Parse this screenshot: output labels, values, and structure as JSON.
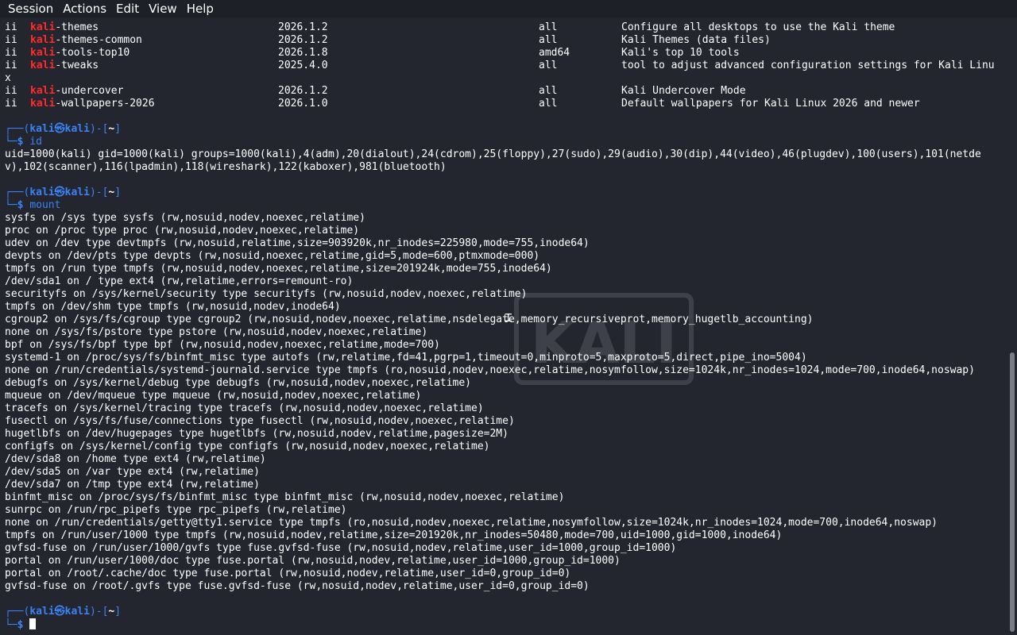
{
  "menubar": {
    "items": [
      "Session",
      "Actions",
      "Edit",
      "View",
      "Help"
    ]
  },
  "packages": [
    {
      "status": "ii",
      "prefix": "kali",
      "suffix": "-themes",
      "version": "2026.1.2",
      "arch": "all",
      "desc": "Configure all desktops to use the Kali theme"
    },
    {
      "status": "ii",
      "prefix": "kali",
      "suffix": "-themes-common",
      "version": "2026.1.2",
      "arch": "all",
      "desc": "Kali Themes (data files)"
    },
    {
      "status": "ii",
      "prefix": "kali",
      "suffix": "-tools-top10",
      "version": "2026.1.8",
      "arch": "amd64",
      "desc": "Kali's top 10 tools"
    },
    {
      "status": "ii",
      "prefix": "kali",
      "suffix": "-tweaks",
      "version": "2025.4.0",
      "arch": "all",
      "desc": "tool to adjust advanced configuration settings for Kali Linu"
    }
  ],
  "tweaks_wrap": "x",
  "packages_after": [
    {
      "status": "ii",
      "prefix": "kali",
      "suffix": "-undercover",
      "version": "2026.1.2",
      "arch": "all",
      "desc": "Kali Undercover Mode"
    },
    {
      "status": "ii",
      "prefix": "kali",
      "suffix": "-wallpapers-2026",
      "version": "2026.1.0",
      "arch": "all",
      "desc": "Default wallpapers for Kali Linux 2026 and newer"
    }
  ],
  "prompt": {
    "top_left": "┌──(",
    "user_host": "kali㉿kali",
    "mid": ")-[",
    "path": "~",
    "end": "]",
    "bottom": "└─",
    "dollar": "$"
  },
  "commands": {
    "id": "id",
    "mount": "mount"
  },
  "id_output": [
    "uid=1000(kali) gid=1000(kali) groups=1000(kali),4(adm),20(dialout),24(cdrom),25(floppy),27(sudo),29(audio),30(dip),44(video),46(plugdev),100(users),101(netde",
    "v),102(scanner),116(lpadmin),118(wireshark),122(kaboxer),981(bluetooth)"
  ],
  "mount_output": [
    "sysfs on /sys type sysfs (rw,nosuid,nodev,noexec,relatime)",
    "proc on /proc type proc (rw,nosuid,nodev,noexec,relatime)",
    "udev on /dev type devtmpfs (rw,nosuid,relatime,size=903920k,nr_inodes=225980,mode=755,inode64)",
    "devpts on /dev/pts type devpts (rw,nosuid,noexec,relatime,gid=5,mode=600,ptmxmode=000)",
    "tmpfs on /run type tmpfs (rw,nosuid,nodev,noexec,relatime,size=201924k,mode=755,inode64)",
    "/dev/sda1 on / type ext4 (rw,relatime,errors=remount-ro)",
    "securityfs on /sys/kernel/security type securityfs (rw,nosuid,nodev,noexec,relatime)",
    "tmpfs on /dev/shm type tmpfs (rw,nosuid,nodev,inode64)",
    "cgroup2 on /sys/fs/cgroup type cgroup2 (rw,nosuid,nodev,noexec,relatime,nsdelegate,memory_recursiveprot,memory_hugetlb_accounting)",
    "none on /sys/fs/pstore type pstore (rw,nosuid,nodev,noexec,relatime)",
    "bpf on /sys/fs/bpf type bpf (rw,nosuid,nodev,noexec,relatime,mode=700)",
    "systemd-1 on /proc/sys/fs/binfmt_misc type autofs (rw,relatime,fd=41,pgrp=1,timeout=0,minproto=5,maxproto=5,direct,pipe_ino=5004)",
    "none on /run/credentials/systemd-journald.service type tmpfs (ro,nosuid,nodev,noexec,relatime,nosymfollow,size=1024k,nr_inodes=1024,mode=700,inode64,noswap)",
    "debugfs on /sys/kernel/debug type debugfs (rw,nosuid,nodev,noexec,relatime)",
    "mqueue on /dev/mqueue type mqueue (rw,nosuid,nodev,noexec,relatime)",
    "tracefs on /sys/kernel/tracing type tracefs (rw,nosuid,nodev,noexec,relatime)",
    "fusectl on /sys/fs/fuse/connections type fusectl (rw,nosuid,nodev,noexec,relatime)",
    "hugetlbfs on /dev/hugepages type hugetlbfs (rw,nosuid,nodev,relatime,pagesize=2M)",
    "configfs on /sys/kernel/config type configfs (rw,nosuid,nodev,noexec,relatime)",
    "/dev/sda8 on /home type ext4 (rw,relatime)",
    "/dev/sda5 on /var type ext4 (rw,relatime)",
    "/dev/sda7 on /tmp type ext4 (rw,relatime)",
    "binfmt_misc on /proc/sys/fs/binfmt_misc type binfmt_misc (rw,nosuid,nodev,noexec,relatime)",
    "sunrpc on /run/rpc_pipefs type rpc_pipefs (rw,relatime)",
    "none on /run/credentials/getty@tty1.service type tmpfs (ro,nosuid,nodev,noexec,relatime,nosymfollow,size=1024k,nr_inodes=1024,mode=700,inode64,noswap)",
    "tmpfs on /run/user/1000 type tmpfs (rw,nosuid,nodev,relatime,size=201920k,nr_inodes=50480,mode=700,uid=1000,gid=1000,inode64)",
    "gvfsd-fuse on /run/user/1000/gvfs type fuse.gvfsd-fuse (rw,nosuid,nodev,relatime,user_id=1000,group_id=1000)",
    "portal on /run/user/1000/doc type fuse.portal (rw,nosuid,nodev,relatime,user_id=1000,group_id=1000)",
    "portal on /root/.cache/doc type fuse.portal (rw,nosuid,nodev,relatime,user_id=0,group_id=0)",
    "gvfsd-fuse on /root/.gvfs type fuse.gvfsd-fuse (rw,nosuid,nodev,relatime,user_id=0,group_id=0)"
  ],
  "colors": {
    "background": "#23262f",
    "prompt_blue": "#3b82f6",
    "kali_red": "#ff2a2a",
    "text": "#ffffff"
  },
  "watermark_text": "KALI"
}
